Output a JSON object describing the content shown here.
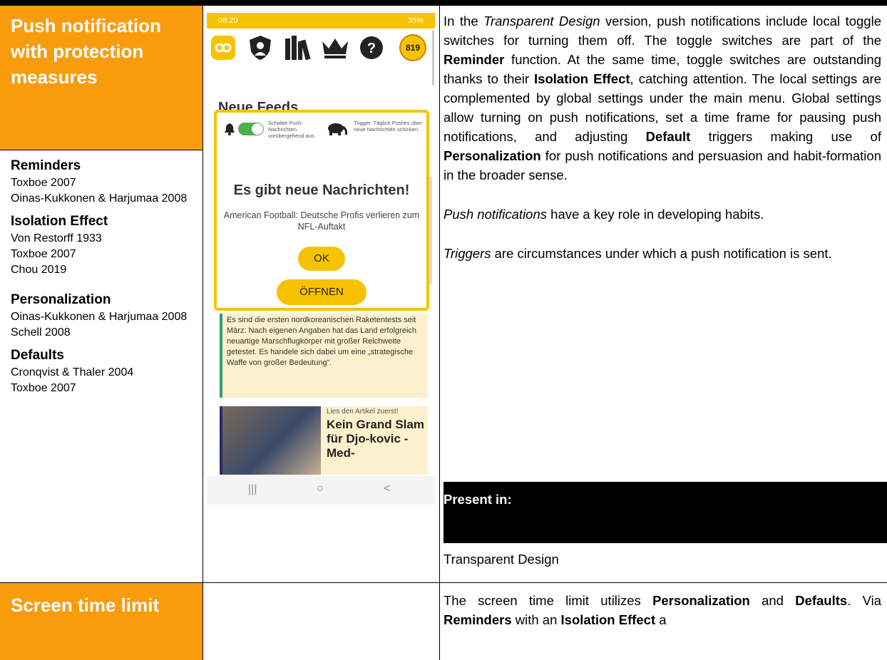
{
  "row1": {
    "title": "Push notification with protection measures",
    "refs": [
      {
        "heading": "Reminders",
        "items": [
          "Toxboe 2007",
          "Oinas-Kukkonen & Harjumaa 2008"
        ]
      },
      {
        "heading": "Isolation Effect",
        "items": [
          "Von Restorff 1933",
          "Toxboe 2007",
          "Chou 2019"
        ]
      },
      {
        "heading": "Personalization",
        "items": [
          "Oinas-Kukkonen & Harjumaa 2008",
          "Schell 2008"
        ]
      },
      {
        "heading": "Defaults",
        "items": [
          "Cronqvist & Thaler 2004",
          "Toxboe 2007"
        ]
      }
    ],
    "desc": {
      "p1_a": "In the ",
      "p1_b": "Transparent Design",
      "p1_c": " version, push notifications include local toggle switches for turning them off. The toggle switches are part of the ",
      "p1_d": "Reminder",
      "p1_e": " function. At the same time, toggle switches are outstanding thanks to their ",
      "p1_f": "Isolation Effect",
      "p1_g": ", catching attention. The local settings are complemented by global settings under the main menu. Global settings allow turning on push notifications, set a time frame for pausing push notifications, and adjusting ",
      "p1_h": "Default",
      "p1_i": " triggers making use of ",
      "p1_j": "Personalization",
      "p1_k": " for push notifications and persuasion and habit-formation in the broader sense.",
      "p2_a": "Push notifications",
      "p2_b": " have a key role in developing habits.",
      "p3_a": "Triggers",
      "p3_b": " are circumstances under which a push notification is sent."
    },
    "present_label": "Present in:",
    "present_value": "Transparent Design"
  },
  "row2": {
    "title": "Screen time limit",
    "desc_a": "The screen time limit utilizes ",
    "desc_b": "Personalization",
    "desc_c": " and ",
    "desc_d": "Defaults",
    "desc_e": ". Via ",
    "desc_f": "Reminders",
    "desc_g": " with an ",
    "desc_h": "Isolation Effect",
    "desc_i": " a"
  },
  "phone": {
    "time": "08:20",
    "status_right": "35%",
    "badge": "819",
    "section": "Neue Feeds",
    "toggle_text": "Schaltet Push-Nachrichten vorübergehend aus.",
    "trigger_text": "Trigger: Täglich Pushes über neue Nachrichten schicken.",
    "dialog_title": "Es gibt neue Nachrichten!",
    "dialog_sub": "American Football: Deutsche Profis verlieren zum NFL-Auftakt",
    "ok_label": "OK",
    "open_label": "ÖFFNEN",
    "article_text": "Es sind die ersten nordkoreanischen Raketentests seit März: Nach eigenen Angaben hat das Land erfolgreich neuartige Marschflugkörper mit großer Reichweite getestet. Es handele sich dabei um eine „strategische Waffe von großer Bedeutung“.",
    "news_kicker": "Lies den Artikel zuerst!",
    "news_head": "Kein Grand Slam für Djo-kovic - Med-",
    "nav": [
      "|||",
      "○",
      "<"
    ]
  },
  "colors": {
    "orange": "#f89c0e",
    "yellow": "#f7c200",
    "black": "#000000"
  }
}
